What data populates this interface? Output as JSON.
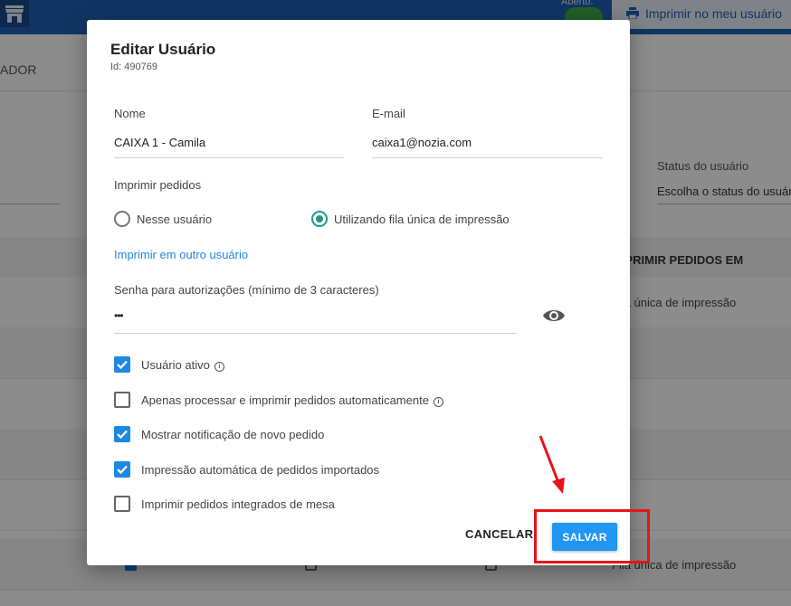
{
  "background": {
    "open_label": "Aberto:",
    "print_button_label": "Imprimir no meu usuário",
    "tab_fragment": "ADOR",
    "status_label": "Status do usuário",
    "status_placeholder": "Escolha o status do usuário",
    "table_header": "IMPRIMIR PEDIDOS EM",
    "row1_text": "Fila única de impressão",
    "row2_text": "Fila única de impressão"
  },
  "modal": {
    "title": "Editar Usuário",
    "id_text": "Id: 490769",
    "name_label": "Nome",
    "name_value": "CAIXA 1 - Camila",
    "email_label": "E-mail",
    "email_value": "caixa1@nozia.com",
    "print_orders_label": "Imprimir pedidos",
    "radio_options": [
      {
        "label": "Nesse usuário",
        "selected": false
      },
      {
        "label": "Utilizando fila única de impressão",
        "selected": true
      }
    ],
    "print_other_user_link": "Imprimir em outro usuário",
    "password_label": "Senha para autorizações (mínimo de 3 caracteres)",
    "password_value": "•••",
    "checkboxes": [
      {
        "label": "Usuário ativo",
        "checked": true,
        "info": true
      },
      {
        "label": "Apenas processar e imprimir pedidos automaticamente",
        "checked": false,
        "info": true
      },
      {
        "label": "Mostrar notificação de novo pedido",
        "checked": true,
        "info": false
      },
      {
        "label": "Impressão automática de pedidos importados",
        "checked": true,
        "info": false
      },
      {
        "label": "Imprimir pedidos integrados de mesa",
        "checked": false,
        "info": false
      }
    ],
    "cancel_label": "CANCELAR",
    "save_label": "SALVAR"
  },
  "colors": {
    "accent": "#2196f3",
    "radio_selected": "#1d9a8a",
    "annotation_red": "#e5141a",
    "topbar": "#1f62b4"
  }
}
